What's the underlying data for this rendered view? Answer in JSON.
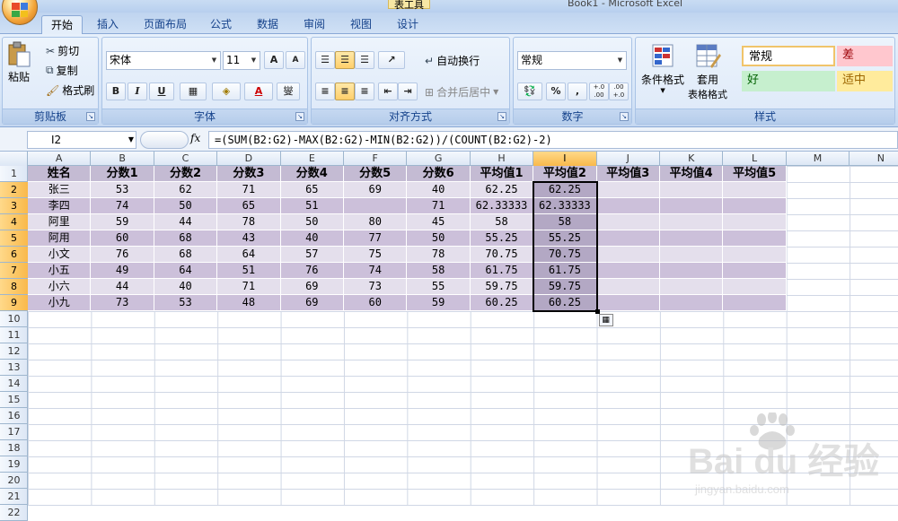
{
  "window": {
    "title": "Book1 - Microsoft Excel",
    "context_tab": "表工具"
  },
  "tabs": [
    "开始",
    "插入",
    "页面布局",
    "公式",
    "数据",
    "审阅",
    "视图",
    "设计"
  ],
  "ribbon": {
    "clipboard": {
      "paste": "粘贴",
      "cut": "剪切",
      "copy": "复制",
      "format_painter": "格式刷",
      "label": "剪贴板"
    },
    "font": {
      "name": "宋体",
      "size": "11",
      "grow": "A",
      "shrink": "A",
      "bold": "B",
      "italic": "I",
      "underline": "U",
      "font_color": "A",
      "phonetic": "燮",
      "label": "字体"
    },
    "align": {
      "wrap": "自动换行",
      "merge": "合并后居中",
      "label": "对齐方式"
    },
    "number": {
      "format": "常规",
      "percent": "%",
      "comma": ",",
      "inc": "+.0 .00",
      "dec": ".00 +.0",
      "label": "数字"
    },
    "styles": {
      "cond_format": "条件格式",
      "table_format_1": "套用",
      "table_format_2": "表格格式",
      "normal": "常规",
      "bad": "差",
      "good": "好",
      "neutral": "适中",
      "label": "样式"
    }
  },
  "formula_bar": {
    "cell_ref": "I2",
    "fx": "fx",
    "formula": "=(SUM(B2:G2)-MAX(B2:G2)-MIN(B2:G2))/(COUNT(B2:G2)-2)"
  },
  "columns": [
    "A",
    "B",
    "C",
    "D",
    "E",
    "F",
    "G",
    "H",
    "I",
    "J",
    "K",
    "L",
    "M",
    "N"
  ],
  "rows": [
    "1",
    "2",
    "3",
    "4",
    "5",
    "6",
    "7",
    "8",
    "9",
    "10",
    "11",
    "12",
    "13",
    "14",
    "15",
    "16",
    "17",
    "18",
    "19",
    "20",
    "21",
    "22"
  ],
  "table": {
    "headers": [
      "姓名",
      "分数1",
      "分数2",
      "分数3",
      "分数4",
      "分数5",
      "分数6",
      "平均值1",
      "平均值2",
      "平均值3",
      "平均值4",
      "平均值5"
    ],
    "rows": [
      [
        "张三",
        "53",
        "62",
        "71",
        "65",
        "69",
        "40",
        "62.25",
        "62.25",
        "",
        "",
        ""
      ],
      [
        "李四",
        "74",
        "50",
        "65",
        "51",
        "",
        "71",
        "62.33333",
        "62.33333",
        "",
        "",
        ""
      ],
      [
        "阿里",
        "59",
        "44",
        "78",
        "50",
        "80",
        "45",
        "58",
        "58",
        "",
        "",
        ""
      ],
      [
        "阿用",
        "60",
        "68",
        "43",
        "40",
        "77",
        "50",
        "55.25",
        "55.25",
        "",
        "",
        ""
      ],
      [
        "小文",
        "76",
        "68",
        "64",
        "57",
        "75",
        "78",
        "70.75",
        "70.75",
        "",
        "",
        ""
      ],
      [
        "小五",
        "49",
        "64",
        "51",
        "76",
        "74",
        "58",
        "61.75",
        "61.75",
        "",
        "",
        ""
      ],
      [
        "小六",
        "44",
        "40",
        "71",
        "69",
        "73",
        "55",
        "59.75",
        "59.75",
        "",
        "",
        ""
      ],
      [
        "小九",
        "73",
        "53",
        "48",
        "69",
        "60",
        "59",
        "60.25",
        "60.25",
        "",
        "",
        ""
      ]
    ]
  },
  "colors": {
    "band_light": "#e4dfec",
    "band_dark": "#ccc0da",
    "header_band": "#c4bbd3",
    "selection": "#b3a8c4"
  },
  "watermark": {
    "brand": "Bai du 经验",
    "url": "jingyan.baidu.com"
  }
}
